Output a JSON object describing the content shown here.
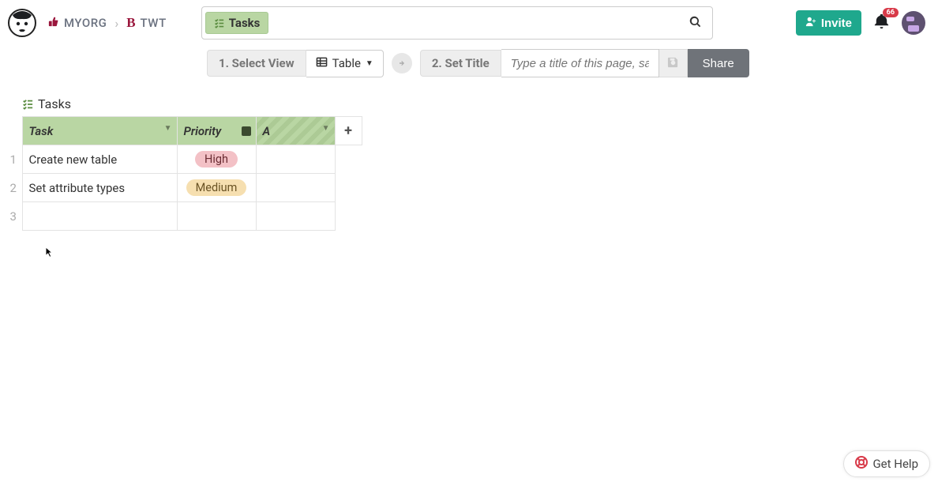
{
  "breadcrumb": {
    "org": "MYORG",
    "project": "TWT"
  },
  "search": {
    "chip_label": "Tasks"
  },
  "header": {
    "invite_label": "Invite",
    "notification_count": "66"
  },
  "toolbar": {
    "step1_label": "1. Select View",
    "view_label": "Table",
    "step2_label": "2. Set Title",
    "title_placeholder": "Type a title of this page, save,",
    "share_label": "Share"
  },
  "table": {
    "title": "Tasks",
    "columns": {
      "task": "Task",
      "priority": "Priority",
      "new": "A",
      "add": "+"
    },
    "rows": [
      {
        "num": "1",
        "task": "Create new table",
        "priority": "High",
        "priority_class": "tag-high"
      },
      {
        "num": "2",
        "task": "Set attribute types",
        "priority": "Medium",
        "priority_class": "tag-medium"
      },
      {
        "num": "3",
        "task": "",
        "priority": "",
        "priority_class": ""
      }
    ]
  },
  "help": {
    "label": "Get Help"
  }
}
